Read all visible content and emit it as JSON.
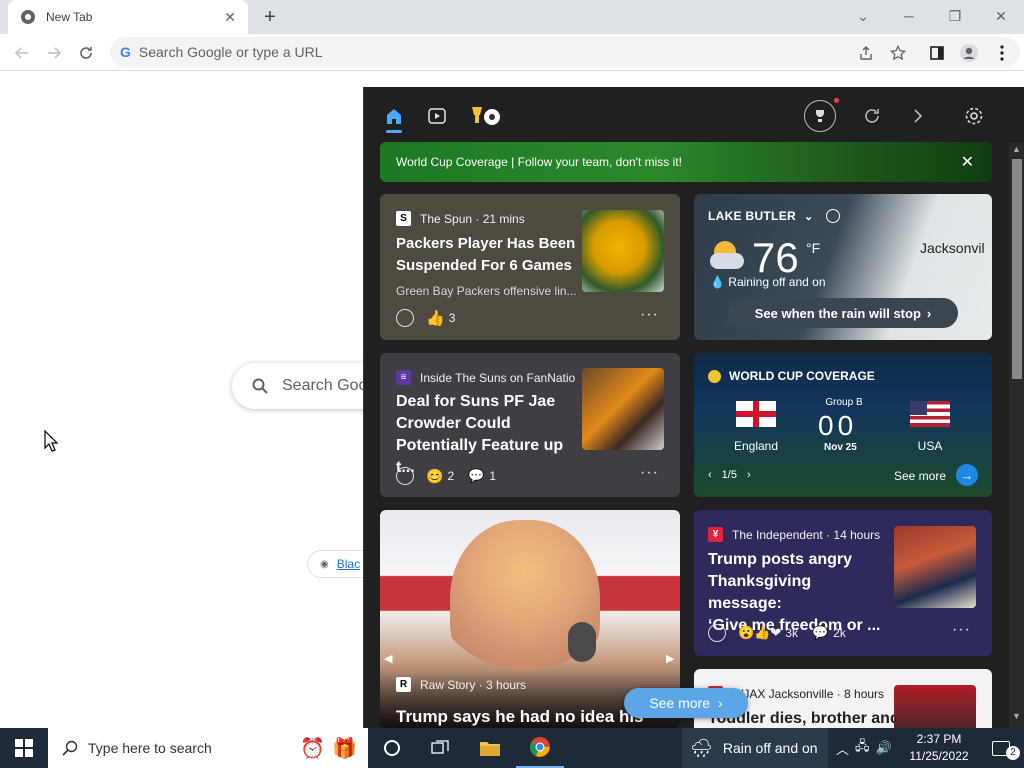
{
  "browser": {
    "tab": {
      "title": "New Tab"
    },
    "omnibox": {
      "placeholder": "Search Google or type a URL"
    }
  },
  "ntp": {
    "search_placeholder": "Search Goo",
    "shortcut_chip": "Blac"
  },
  "widgets": {
    "banner": {
      "text": "World Cup Coverage | Follow your team, don't miss it!"
    },
    "cards": {
      "spun": {
        "source": "The Spun · 21 mins",
        "headline_l1": "Packers Player Has Been",
        "headline_l2": "Suspended For 6 Games",
        "snippet": "Green Bay Packers offensive lin...",
        "likes": "3"
      },
      "suns": {
        "source": "Inside The Suns on FanNatio",
        "headline_l1": "Deal for Suns PF Jae",
        "headline_l2": "Crowder Could",
        "headline_l3": "Potentially Feature up t...",
        "reactions": "2",
        "comments": "1"
      },
      "weather": {
        "location": "LAKE BUTLER",
        "temperature": "76",
        "unit": "°F",
        "condition": "Raining off and on",
        "map_city": "Jacksonvil",
        "cta": "See when the rain will stop"
      },
      "worldcup": {
        "header": "WORLD CUP COVERAGE",
        "group": "Group B",
        "team_home": "England",
        "team_away": "USA",
        "score_home": "0",
        "score_away": "0",
        "date": "Nov 25",
        "pager": "1/5",
        "see_more": "See more"
      },
      "rawstory": {
        "source": "Raw Story · 3 hours",
        "headline": "Trump says he had no idea his"
      },
      "independent": {
        "source": "The Independent · 14 hours",
        "headline_l1": "Trump posts angry",
        "headline_l2": "Thanksgiving message:",
        "headline_l3": "‘Give me freedom or ...",
        "reactions": "3k",
        "comments": "2k"
      },
      "wjax": {
        "source": "WJAX Jacksonville · 8 hours",
        "headline": "Toddler dies, brother and"
      }
    },
    "see_more": "See more"
  },
  "taskbar": {
    "search_placeholder": "Type here to search",
    "weather": "Rain off and on",
    "time": "2:37 PM",
    "date": "11/25/2022",
    "notifications": "2"
  },
  "colors": {
    "accent": "#4aa8ff",
    "banner_green": "#1b7a22",
    "taskbar": "#1f2a38",
    "panel_bg": "#202020"
  }
}
